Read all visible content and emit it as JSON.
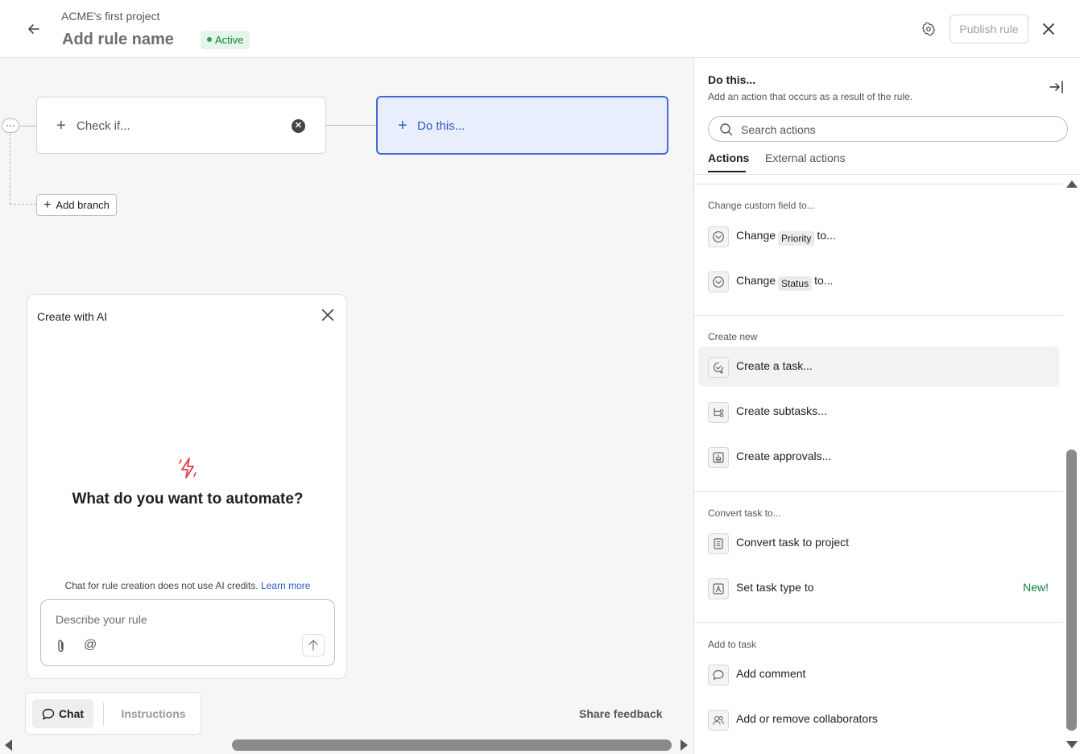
{
  "header": {
    "project_name": "ACME's first project",
    "rule_name": "Add rule name",
    "status": "Active",
    "publish_label": "Publish rule",
    "icons": [
      "back-arrow-icon",
      "gear-icon",
      "close-icon"
    ]
  },
  "canvas": {
    "check_label": "Check if...",
    "do_label": "Do this...",
    "add_branch_label": "Add branch"
  },
  "ai_panel": {
    "title": "Create with AI",
    "question": "What do you want to automate?",
    "note": "Chat for rule creation does not use AI credits.",
    "learn_more": "Learn more",
    "input_placeholder": "Describe your rule"
  },
  "bottom_bar": {
    "chat_label": "Chat",
    "instructions_label": "Instructions",
    "share_feedback": "Share feedback"
  },
  "side_panel": {
    "title": "Do this...",
    "subtitle": "Add an action that occurs as a result of the rule.",
    "search_placeholder": "Search actions",
    "tabs": [
      "Actions",
      "External actions"
    ],
    "sections": [
      {
        "label": "Change custom field to...",
        "items": [
          {
            "pre": "Change",
            "chip": "Priority",
            "post": "to..."
          },
          {
            "pre": "Change",
            "chip": "Status",
            "post": "to..."
          }
        ]
      },
      {
        "label": "Create new",
        "items": [
          {
            "text": "Create a task..."
          },
          {
            "text": "Create subtasks..."
          },
          {
            "text": "Create approvals..."
          }
        ]
      },
      {
        "label": "Convert task to...",
        "items": [
          {
            "text": "Convert task to project"
          },
          {
            "text": "Set task type to",
            "badge": "New!"
          }
        ]
      },
      {
        "label": "Add to task",
        "items": [
          {
            "text": "Add comment"
          },
          {
            "text": "Add or remove collaborators"
          }
        ]
      }
    ]
  },
  "colors": {
    "accent_blue": "#3f6dd4",
    "active_green": "#0d7f3d",
    "ai_bolt": "#e8384f"
  }
}
